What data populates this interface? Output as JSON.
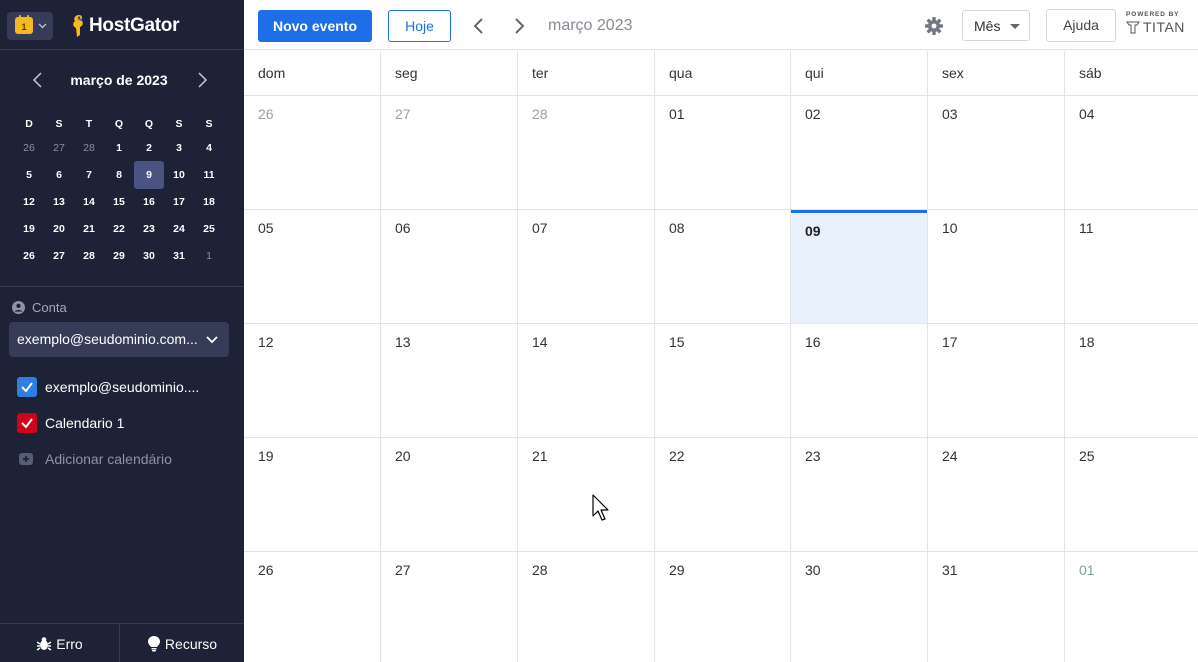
{
  "app": {
    "switcher_day": "1",
    "brand": "HostGator",
    "powered_small": "POWERED BY",
    "powered_brand": "TITAN"
  },
  "sidebar": {
    "mini_title": "março de 2023",
    "weekdays": [
      "D",
      "S",
      "T",
      "Q",
      "Q",
      "S",
      "S"
    ],
    "weeks": [
      [
        {
          "d": "26",
          "o": true
        },
        {
          "d": "27",
          "o": true
        },
        {
          "d": "28",
          "o": true
        },
        {
          "d": "1"
        },
        {
          "d": "2"
        },
        {
          "d": "3"
        },
        {
          "d": "4"
        }
      ],
      [
        {
          "d": "5"
        },
        {
          "d": "6"
        },
        {
          "d": "7"
        },
        {
          "d": "8"
        },
        {
          "d": "9",
          "s": true
        },
        {
          "d": "10"
        },
        {
          "d": "11"
        }
      ],
      [
        {
          "d": "12"
        },
        {
          "d": "13"
        },
        {
          "d": "14"
        },
        {
          "d": "15"
        },
        {
          "d": "16"
        },
        {
          "d": "17"
        },
        {
          "d": "18"
        }
      ],
      [
        {
          "d": "19"
        },
        {
          "d": "20"
        },
        {
          "d": "21"
        },
        {
          "d": "22"
        },
        {
          "d": "23"
        },
        {
          "d": "24"
        },
        {
          "d": "25"
        }
      ],
      [
        {
          "d": "26"
        },
        {
          "d": "27"
        },
        {
          "d": "28"
        },
        {
          "d": "29"
        },
        {
          "d": "30"
        },
        {
          "d": "31"
        },
        {
          "d": "1",
          "o": true
        }
      ]
    ],
    "account_label": "Conta",
    "account_value": "exemplo@seudominio.com.br",
    "calendars": [
      {
        "label": "exemplo@seudominio.com.br",
        "color": "#2f7de1"
      },
      {
        "label": "Calendario 1",
        "color": "#d0021b"
      }
    ],
    "add_calendar": "Adicionar calendário",
    "bug_label": "Erro",
    "feature_label": "Recurso"
  },
  "toolbar": {
    "new_event": "Novo evento",
    "today": "Hoje",
    "title": "março 2023",
    "view": "Mês",
    "help": "Ajuda"
  },
  "month": {
    "weekdays": [
      "dom",
      "seg",
      "ter",
      "qua",
      "qui",
      "sex",
      "sáb"
    ],
    "weeks": [
      [
        {
          "d": "26",
          "t": "other"
        },
        {
          "d": "27",
          "t": "other"
        },
        {
          "d": "28",
          "t": "other"
        },
        {
          "d": "01"
        },
        {
          "d": "02"
        },
        {
          "d": "03"
        },
        {
          "d": "04"
        }
      ],
      [
        {
          "d": "05"
        },
        {
          "d": "06"
        },
        {
          "d": "07"
        },
        {
          "d": "08"
        },
        {
          "d": "09",
          "t": "today"
        },
        {
          "d": "10"
        },
        {
          "d": "11"
        }
      ],
      [
        {
          "d": "12"
        },
        {
          "d": "13"
        },
        {
          "d": "14"
        },
        {
          "d": "15"
        },
        {
          "d": "16"
        },
        {
          "d": "17"
        },
        {
          "d": "18"
        }
      ],
      [
        {
          "d": "19"
        },
        {
          "d": "20"
        },
        {
          "d": "21"
        },
        {
          "d": "22"
        },
        {
          "d": "23"
        },
        {
          "d": "24"
        },
        {
          "d": "25"
        }
      ],
      [
        {
          "d": "26"
        },
        {
          "d": "27"
        },
        {
          "d": "28"
        },
        {
          "d": "29"
        },
        {
          "d": "30"
        },
        {
          "d": "31"
        },
        {
          "d": "01",
          "t": "next"
        }
      ]
    ]
  },
  "colors": {
    "sidebar_bg": "#1d2236",
    "accent": "#1e6ee8",
    "today_bg": "#e8f1fc",
    "brand_icon": "#f5b820"
  }
}
